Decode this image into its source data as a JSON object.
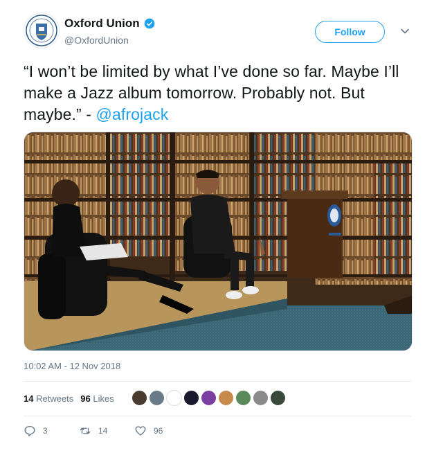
{
  "account": {
    "display_name": "Oxford Union",
    "handle": "@OxfordUnion",
    "verified_icon": "verified-badge-icon",
    "avatar_icon": "oxford-union-crest"
  },
  "follow_label": "Follow",
  "tweet": {
    "text": "“I won’t be limited by what I’ve done so far. Maybe I’ll make a Jazz album tomorrow. Probably not. But maybe.” - ",
    "mention": "@afrojack"
  },
  "timestamp": "10:02 AM - 12 Nov 2018",
  "stats": {
    "retweets_count": "14",
    "retweets_label": "Retweets",
    "likes_count": "96",
    "likes_label": "Likes"
  },
  "actions": {
    "reply_count": "3",
    "retweet_count": "14",
    "like_count": "96"
  },
  "colors": {
    "accent": "#1da1f2",
    "text": "#14171a",
    "muted": "#657786"
  }
}
